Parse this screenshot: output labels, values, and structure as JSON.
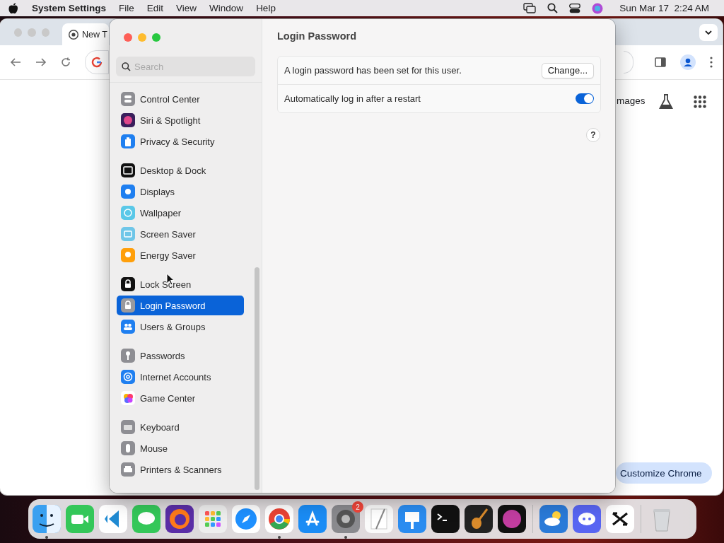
{
  "menubar": {
    "app": "System Settings",
    "menus": [
      "File",
      "Edit",
      "View",
      "Window",
      "Help"
    ],
    "clock": "Sun Mar 17  2:24 AM"
  },
  "browser": {
    "tab_title": "New T",
    "images_link": "mages",
    "customize_button": "Customize Chrome"
  },
  "settings": {
    "search": {
      "placeholder": "Search"
    },
    "sidebar": [
      [
        {
          "label": "Control Center",
          "kind": "control",
          "selected": false
        },
        {
          "label": "Siri & Spotlight",
          "kind": "siri",
          "selected": false
        },
        {
          "label": "Privacy & Security",
          "kind": "privacy",
          "selected": false
        }
      ],
      [
        {
          "label": "Desktop & Dock",
          "kind": "desktop",
          "selected": false
        },
        {
          "label": "Displays",
          "kind": "displays",
          "selected": false
        },
        {
          "label": "Wallpaper",
          "kind": "wallpaper",
          "selected": false
        },
        {
          "label": "Screen Saver",
          "kind": "screensaver",
          "selected": false
        },
        {
          "label": "Energy Saver",
          "kind": "energy",
          "selected": false
        }
      ],
      [
        {
          "label": "Lock Screen",
          "kind": "lock",
          "selected": false
        },
        {
          "label": "Login Password",
          "kind": "login",
          "selected": true
        },
        {
          "label": "Users & Groups",
          "kind": "users",
          "selected": false
        }
      ],
      [
        {
          "label": "Passwords",
          "kind": "passwords",
          "selected": false
        },
        {
          "label": "Internet Accounts",
          "kind": "internet",
          "selected": false
        },
        {
          "label": "Game Center",
          "kind": "gamecenter",
          "selected": false
        }
      ],
      [
        {
          "label": "Keyboard",
          "kind": "keyboard",
          "selected": false
        },
        {
          "label": "Mouse",
          "kind": "mouse",
          "selected": false
        },
        {
          "label": "Printers & Scanners",
          "kind": "printers",
          "selected": false
        }
      ]
    ],
    "title": "Login Password",
    "rows": [
      {
        "kind": "button",
        "label": "A login password has been set for this user.",
        "button": "Change..."
      },
      {
        "kind": "toggle",
        "label": "Automatically log in after a restart",
        "on": true
      }
    ],
    "help": "?"
  },
  "dock": [
    {
      "kind": "finder",
      "running": true
    },
    {
      "kind": "facetime"
    },
    {
      "kind": "vscode"
    },
    {
      "kind": "messages"
    },
    {
      "kind": "firefox"
    },
    {
      "kind": "launchpad"
    },
    {
      "kind": "safari"
    },
    {
      "kind": "chrome",
      "running": true
    },
    {
      "kind": "appstore"
    },
    {
      "kind": "settings",
      "running": true,
      "badge": "2"
    },
    {
      "kind": "textedit"
    },
    {
      "kind": "keynote"
    },
    {
      "kind": "terminal"
    },
    {
      "kind": "garageband"
    },
    {
      "kind": "siri"
    },
    {
      "kind": "separator"
    },
    {
      "kind": "weather"
    },
    {
      "kind": "discord"
    },
    {
      "kind": "capcut"
    },
    {
      "kind": "separator"
    },
    {
      "kind": "trash"
    }
  ]
}
